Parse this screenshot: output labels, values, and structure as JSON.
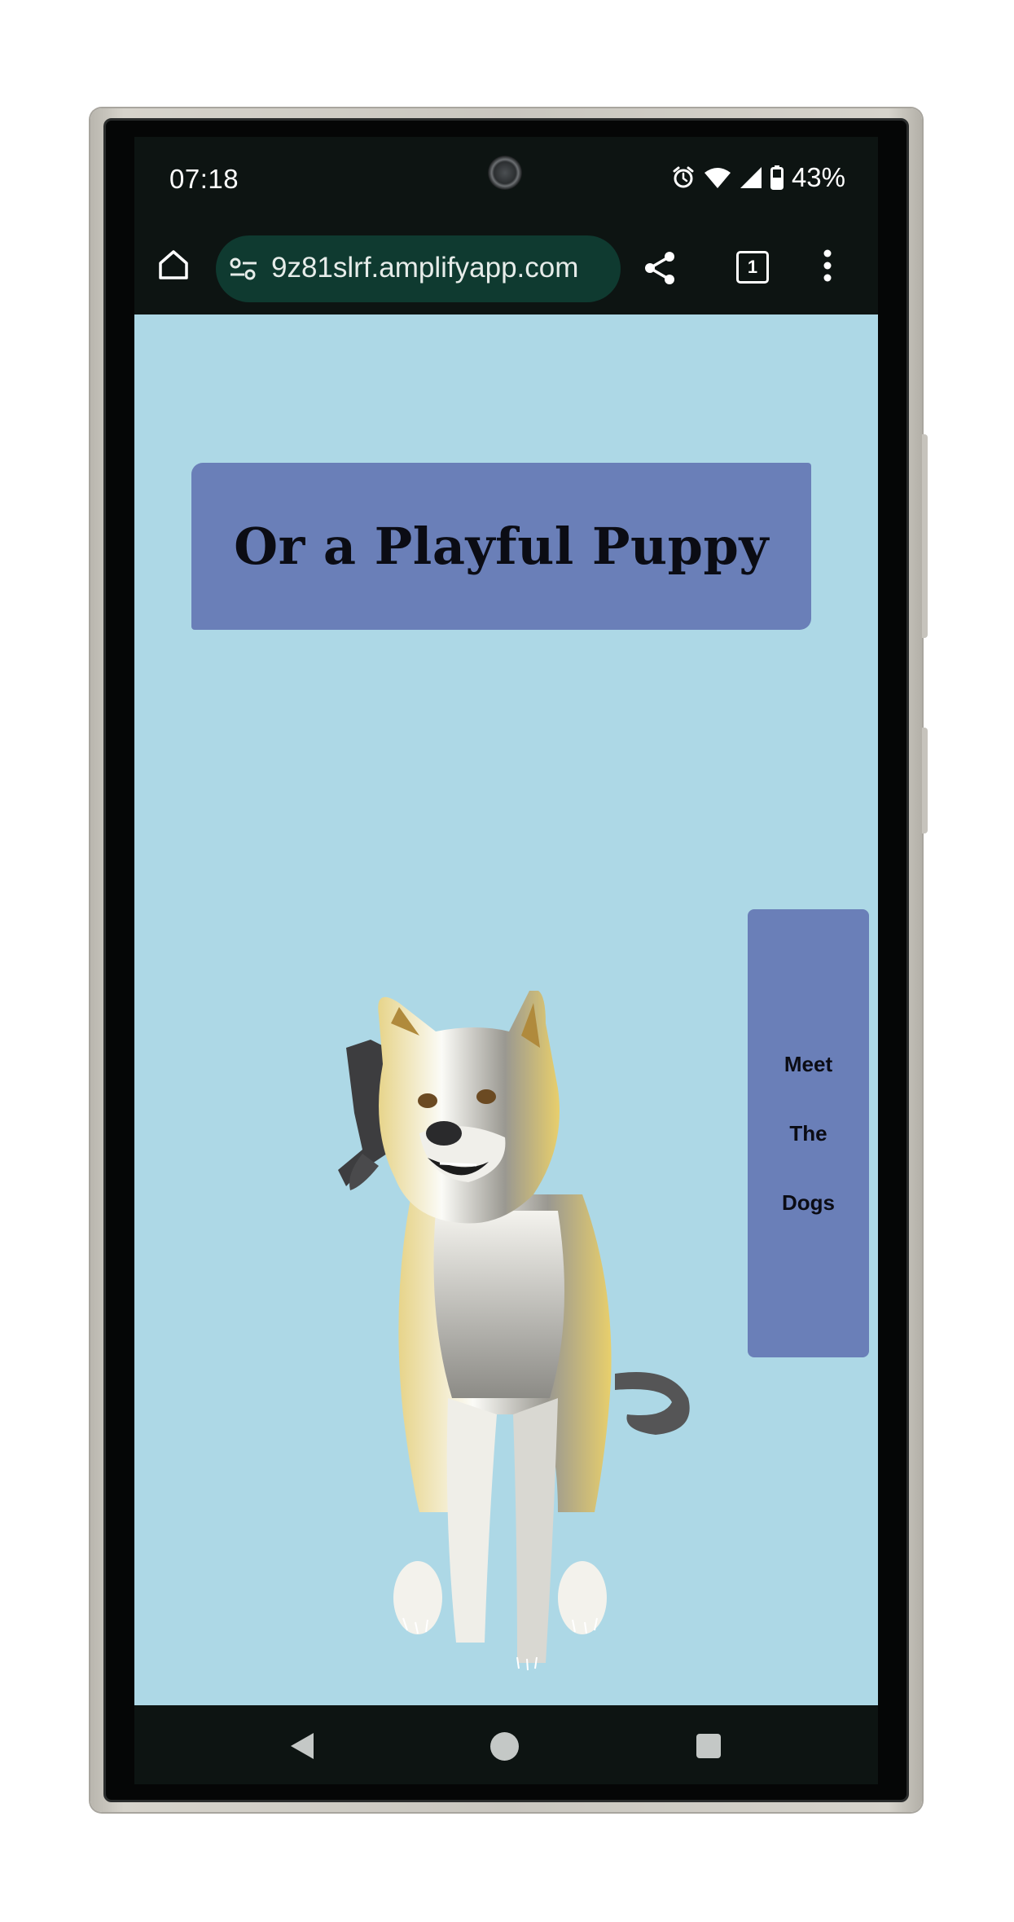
{
  "status_bar": {
    "time": "07:18",
    "battery": "43%",
    "icons": [
      "alarm-icon",
      "wifi-icon",
      "signal-icon",
      "battery-icon"
    ]
  },
  "browser": {
    "url": "9z81slrf.amplifyapp.com",
    "tab_count": "1",
    "icons": [
      "home-icon",
      "tune-icon",
      "share-icon",
      "tabs-icon",
      "more-vert-icon"
    ]
  },
  "page": {
    "heading": "Or a Playful Puppy",
    "side_card": {
      "line1": "Meet",
      "line2": "The",
      "line3": "Dogs"
    },
    "background_color": "#add8e6",
    "box_color": "#6a7fb8"
  },
  "nav_bar": {
    "icons": [
      "back-icon",
      "home-circle-icon",
      "recents-icon"
    ]
  }
}
